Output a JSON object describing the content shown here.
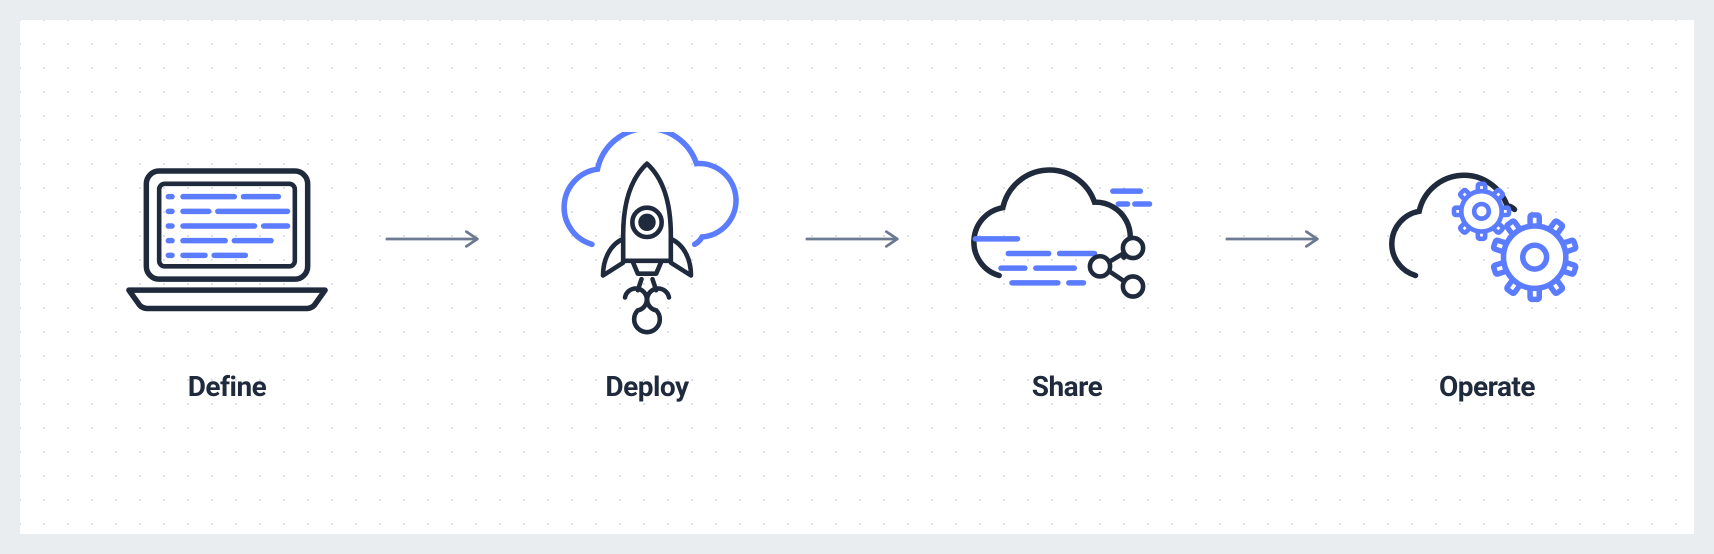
{
  "colors": {
    "stroke_dark": "#1f2a3d",
    "stroke_accent": "#5b7cff",
    "arrow": "#6b7a90",
    "bg_outer": "#e9edf0",
    "bg_inner": "#ffffff",
    "dot": "#d7dde3"
  },
  "steps": [
    {
      "key": "define",
      "label": "Define"
    },
    {
      "key": "deploy",
      "label": "Deploy"
    },
    {
      "key": "share",
      "label": "Share"
    },
    {
      "key": "operate",
      "label": "Operate"
    }
  ]
}
